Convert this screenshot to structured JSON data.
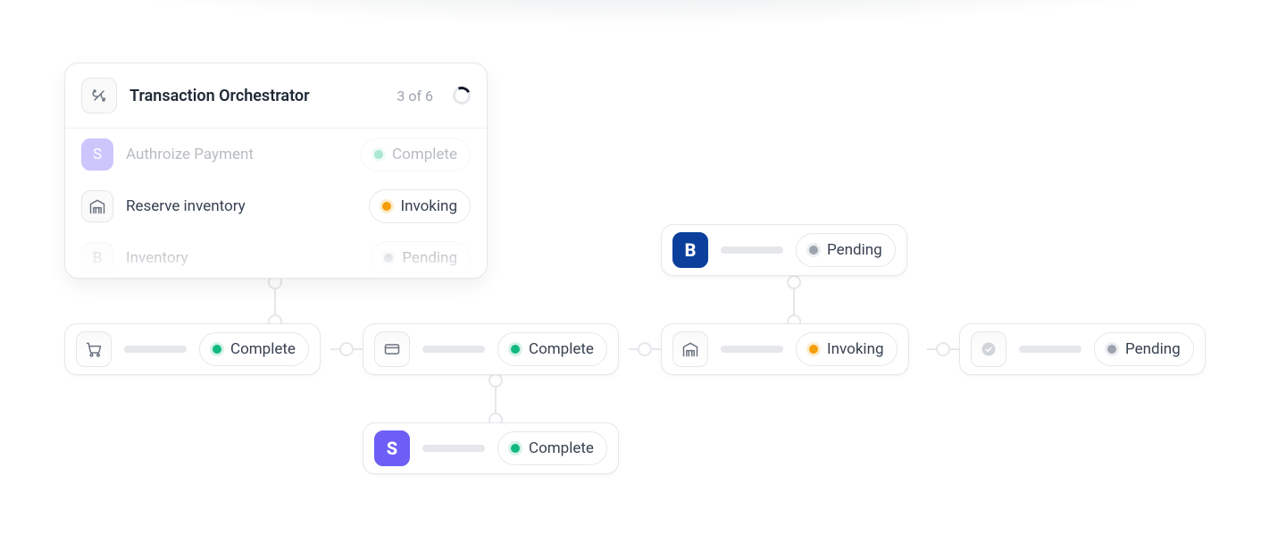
{
  "panel": {
    "title": "Transaction Orchestrator",
    "progress_text": "3 of 6",
    "rows": [
      {
        "icon": "S",
        "label": "Authroize Payment",
        "status": "Complete",
        "status_kind": "complete",
        "faded": true
      },
      {
        "icon": "warehouse",
        "label": "Reserve inventory",
        "status": "Invoking",
        "status_kind": "invoking",
        "faded": false
      },
      {
        "icon": "B",
        "label": "Inventory",
        "status": "Pending",
        "status_kind": "pending",
        "faded": true
      }
    ]
  },
  "nodes": {
    "row": [
      {
        "id": "n1",
        "icon": "cart",
        "status": "Complete",
        "status_kind": "complete"
      },
      {
        "id": "n2",
        "icon": "card",
        "status": "Complete",
        "status_kind": "complete"
      },
      {
        "id": "n3",
        "icon": "warehouse",
        "status": "Invoking",
        "status_kind": "invoking"
      },
      {
        "id": "n4",
        "icon": "check",
        "status": "Pending",
        "status_kind": "pending"
      }
    ],
    "top_branch": {
      "id": "nB",
      "icon": "B",
      "status": "Pending",
      "status_kind": "pending"
    },
    "bottom_branch": {
      "id": "nS",
      "icon": "S",
      "status": "Complete",
      "status_kind": "complete"
    }
  },
  "status_labels": {
    "complete": "Complete",
    "invoking": "Invoking",
    "pending": "Pending"
  }
}
